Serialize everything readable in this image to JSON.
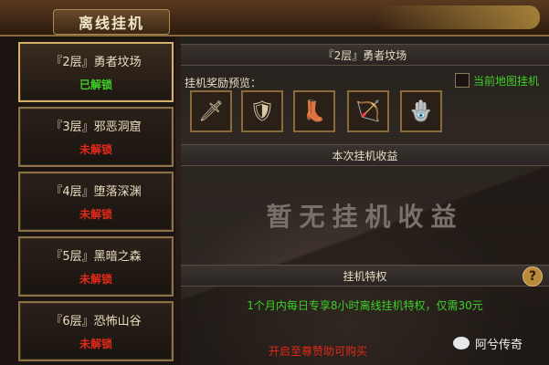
{
  "window": {
    "title": "离线挂机"
  },
  "floors": [
    {
      "name": "『2层』勇者坟场",
      "status": "已解锁",
      "unlocked": true
    },
    {
      "name": "『3层』邪恶洞窟",
      "status": "未解锁",
      "unlocked": false
    },
    {
      "name": "『4层』堕落深渊",
      "status": "未解锁",
      "unlocked": false
    },
    {
      "name": "『5层』黑暗之森",
      "status": "未解锁",
      "unlocked": false
    },
    {
      "name": "『6层』恐怖山谷",
      "status": "未解锁",
      "unlocked": false
    }
  ],
  "detail": {
    "header": "『2层』勇者坟场",
    "reward_preview_label": "挂机奖励预览：",
    "current_map_checkbox_label": "当前地图挂机",
    "rewards": [
      {
        "icon": "sword-icon",
        "glyph": "🗡"
      },
      {
        "icon": "armor-icon",
        "glyph": "🛡"
      },
      {
        "icon": "boots-icon",
        "glyph": "👢"
      },
      {
        "icon": "bow-icon",
        "glyph": "🏹"
      },
      {
        "icon": "shield-icon",
        "glyph": "🪬"
      }
    ],
    "income_header": "本次挂机收益",
    "empty_income": "暂无挂机收益",
    "privilege_header": "挂机特权",
    "help_glyph": "?",
    "privilege_text": "1个月内每日专享8小时离线挂机特权，仅需30元",
    "activate_text": "开启至尊赞助可购买"
  },
  "watermark": {
    "text": "阿兮传奇"
  }
}
